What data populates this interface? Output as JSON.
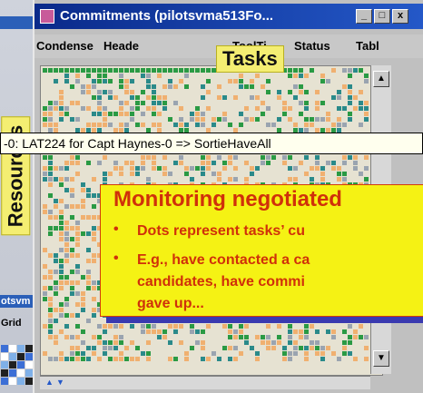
{
  "window": {
    "title": "Commitments (pilotsvma513Fo...",
    "minimize": "_",
    "maximize": "□",
    "close": "x"
  },
  "menu": {
    "items": [
      "Condense",
      "Heade",
      "ToolTi",
      "Status",
      "Tabl"
    ]
  },
  "overlays": {
    "tasks": "Tasks",
    "resources": "Resources"
  },
  "tooltip": {
    "text": "-0: LAT224 for Capt Haynes-0 => SortieHaveAll"
  },
  "callout": {
    "title": "Monitoring negotiated",
    "bullets": [
      "Dots represent tasks’ cu",
      "E.g., have contacted a ca",
      "candidates, have commi",
      "gave up..."
    ]
  },
  "background_window": {
    "labels": [
      "otsvm",
      "Grid"
    ]
  },
  "colors": {
    "accent": "#d0300a",
    "callout_bg": "#f5f214",
    "titlebar": "#0a2a8a",
    "cell_green": "#2a9a44",
    "cell_orange": "#f0b070",
    "cell_blue": "#3c6fd6",
    "cell_teal": "#2a8a8a",
    "cell_grey": "#9aa4b0"
  }
}
